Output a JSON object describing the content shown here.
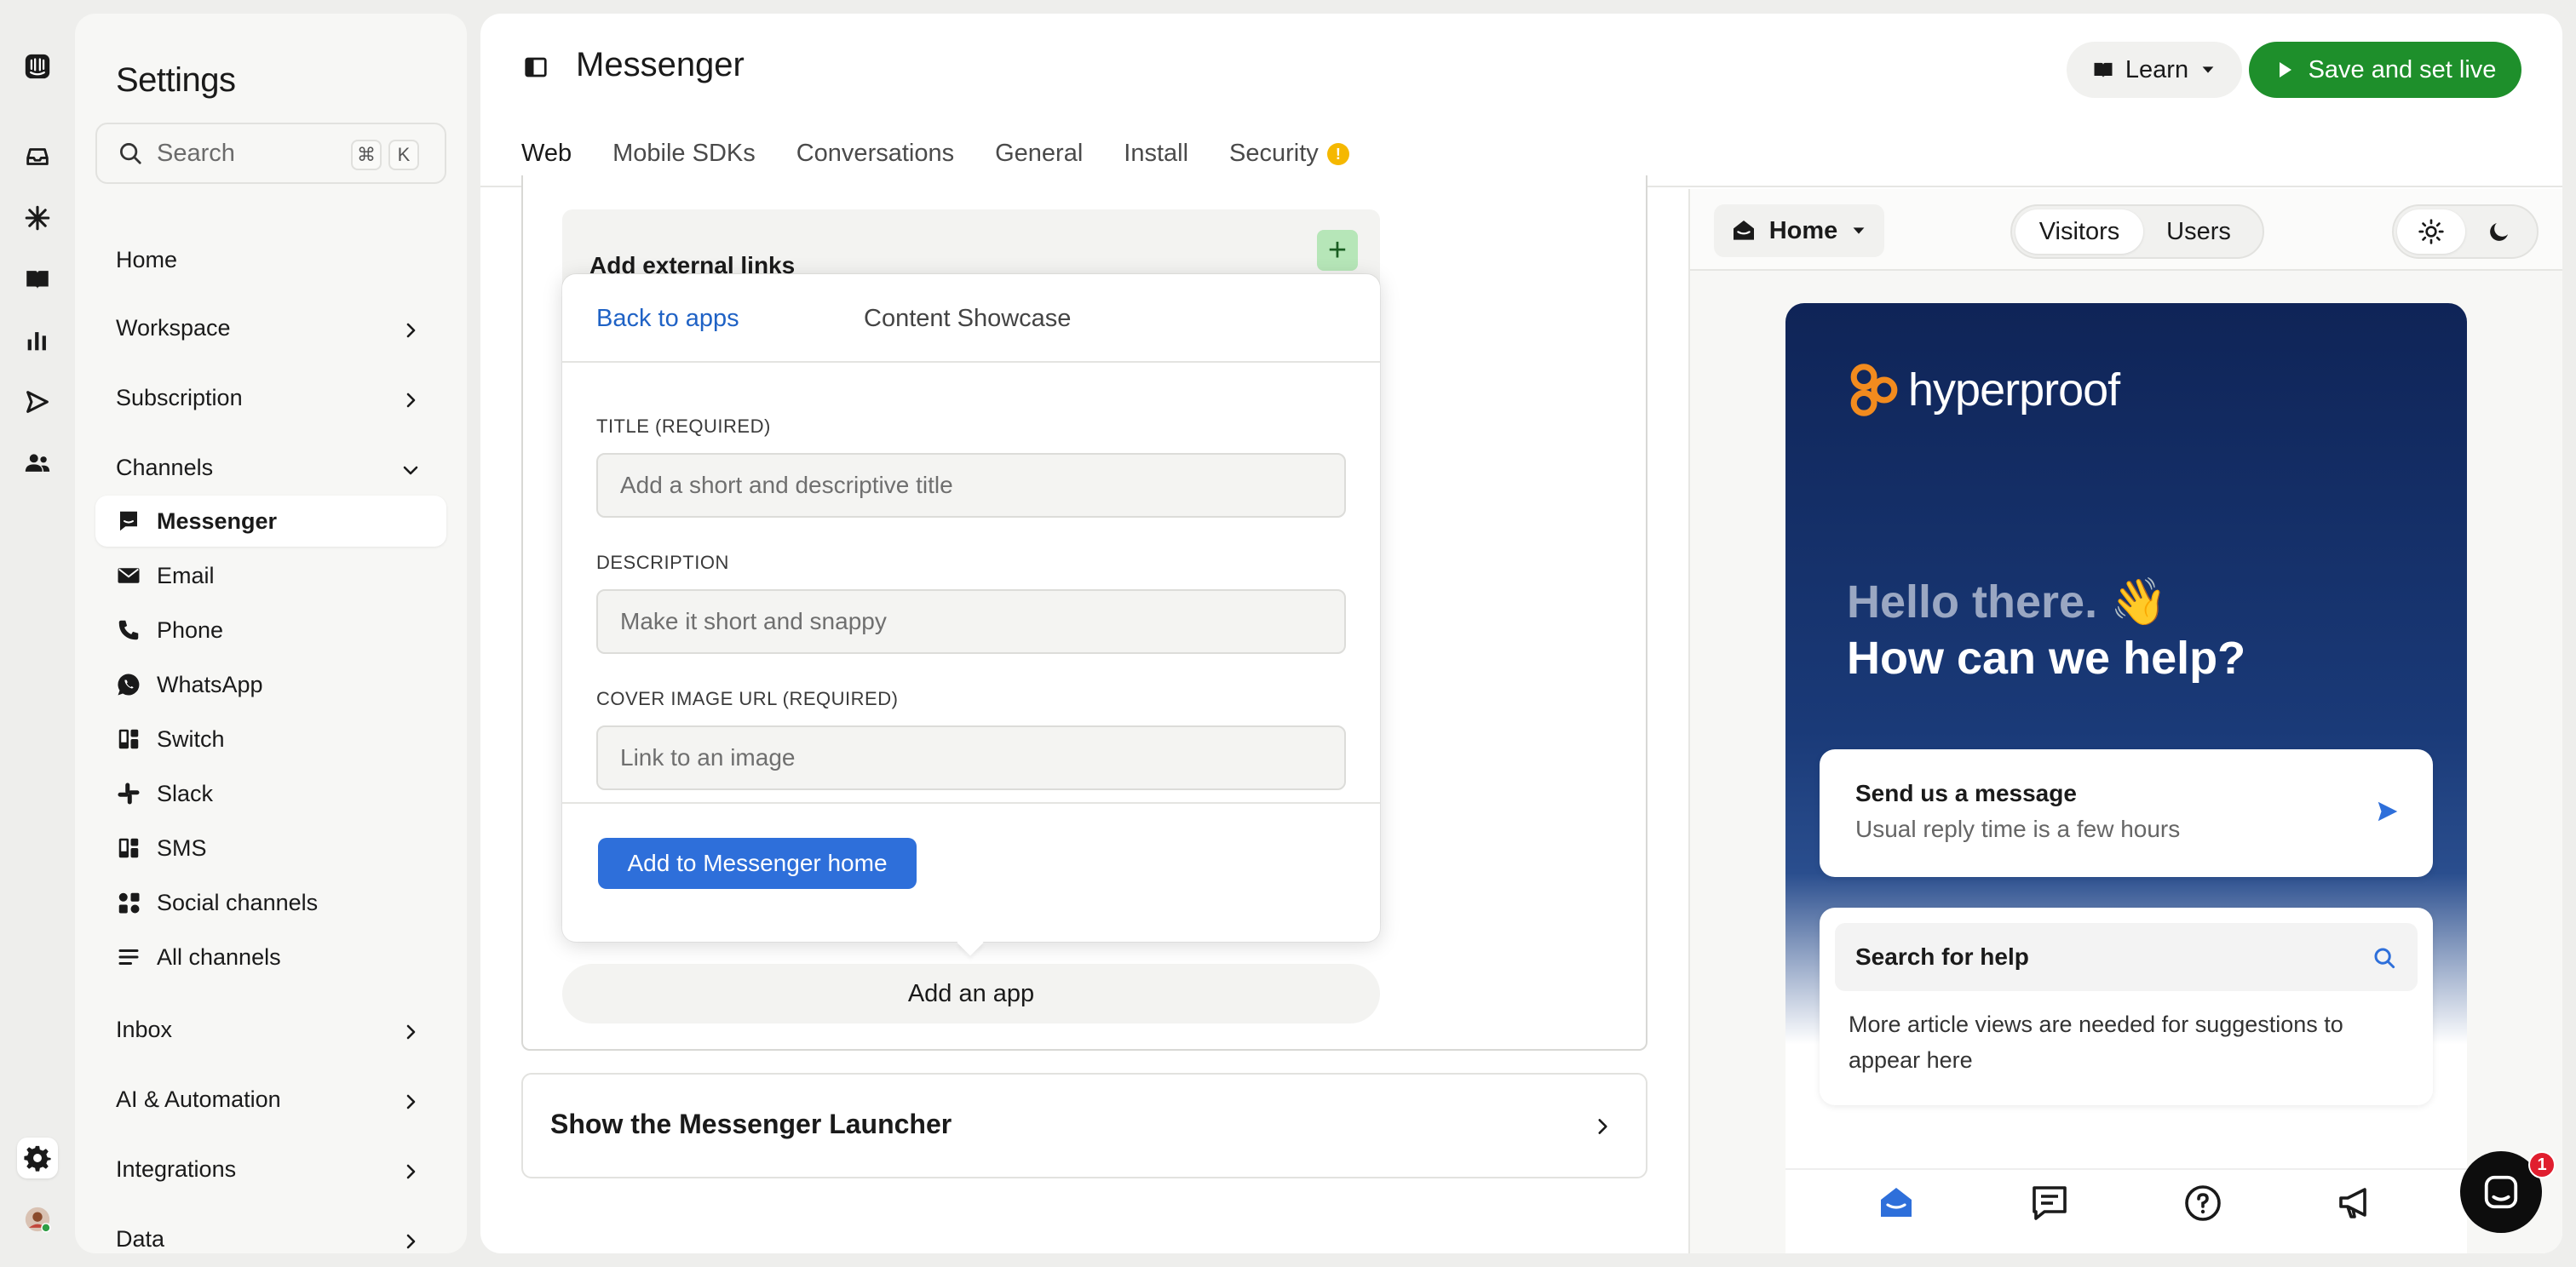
{
  "rail": {
    "items": [
      "intercom-logo-icon",
      "inbox-icon",
      "fin-icon",
      "knowledge-icon",
      "reports-icon",
      "outbound-icon",
      "contacts-icon",
      "settings-icon",
      "avatar"
    ]
  },
  "sidebar": {
    "title": "Settings",
    "search_placeholder": "Search",
    "shortcut_cmd": "⌘",
    "shortcut_k": "K",
    "sections": [
      {
        "label": "Home"
      },
      {
        "label": "Workspace"
      },
      {
        "label": "Subscription"
      },
      {
        "label": "Channels"
      },
      {
        "label": "Inbox"
      },
      {
        "label": "AI & Automation"
      },
      {
        "label": "Integrations"
      },
      {
        "label": "Data"
      }
    ],
    "channels": [
      {
        "label": "Messenger",
        "icon": "messenger-icon"
      },
      {
        "label": "Email",
        "icon": "email-icon"
      },
      {
        "label": "Phone",
        "icon": "phone-icon"
      },
      {
        "label": "WhatsApp",
        "icon": "whatsapp-icon"
      },
      {
        "label": "Switch",
        "icon": "switch-icon"
      },
      {
        "label": "Slack",
        "icon": "slack-icon"
      },
      {
        "label": "SMS",
        "icon": "sms-icon"
      },
      {
        "label": "Social channels",
        "icon": "social-icon"
      },
      {
        "label": "All channels",
        "icon": "list-icon"
      }
    ]
  },
  "header": {
    "title": "Messenger",
    "learn_label": "Learn",
    "save_live_label": "Save and set live",
    "warning_symbol": "!",
    "tabs": [
      {
        "label": "Web"
      },
      {
        "label": "Mobile SDKs"
      },
      {
        "label": "Conversations"
      },
      {
        "label": "General"
      },
      {
        "label": "Install"
      },
      {
        "label": "Security"
      }
    ]
  },
  "editor": {
    "external_links_label": "Add external links",
    "plus_symbol": "+",
    "popover": {
      "back_label": "Back to apps",
      "app_name": "Content Showcase",
      "title_label": "TITLE (REQUIRED)",
      "title_placeholder": "Add a short and descriptive title",
      "description_label": "DESCRIPTION",
      "description_placeholder": "Make it short and snappy",
      "cover_label": "COVER IMAGE URL (REQUIRED)",
      "cover_placeholder": "Link to an image",
      "submit_label": "Add to Messenger home"
    },
    "add_app_label": "Add an app",
    "launcher_section_label": "Show the Messenger Launcher"
  },
  "preview": {
    "page_select": "Home",
    "audience_options": [
      "Visitors",
      "Users"
    ],
    "brand_word": "hyperproof",
    "greeting": "Hello there. 👋",
    "headline": "How can we help?",
    "send_title": "Send us a message",
    "send_subtitle": "Usual reply time is a few hours",
    "search_title": "Search for help",
    "search_note": "More article views are needed for suggestions to appear here",
    "launcher_badge": "1"
  },
  "colors": {
    "accent_green": "#1e8f2b",
    "accent_blue": "#2e6fda",
    "tab_underline": "#e8611a",
    "brand_orange": "#f28b1e",
    "messenger_dark": "#0f2457"
  }
}
